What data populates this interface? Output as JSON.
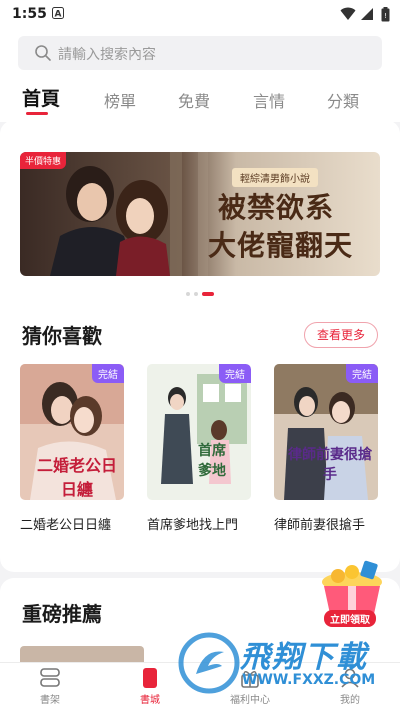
{
  "status_bar": {
    "time": "1:55"
  },
  "search": {
    "placeholder": "請輸入搜索內容"
  },
  "tabs": [
    {
      "label": "首頁",
      "active": true
    },
    {
      "label": "榜單",
      "active": false
    },
    {
      "label": "免費",
      "active": false
    },
    {
      "label": "言情",
      "active": false
    },
    {
      "label": "分類",
      "active": false
    }
  ],
  "banner": {
    "tag": "半價特惠",
    "subtitle": "輕綜清男飾小說",
    "title_line1": "被禁欲系",
    "title_line2": "大佬寵翻天"
  },
  "carousel": {
    "count": 3,
    "active_index": 2
  },
  "guess_section": {
    "title": "猜你喜歡",
    "more_label": "查看更多",
    "books": [
      {
        "title": "二婚老公日日纏",
        "badge": "完結",
        "cover_text": "二婚老公日日纏"
      },
      {
        "title": "首席爹地找上門",
        "badge": "完結",
        "cover_text": "首席爹地"
      },
      {
        "title": "律師前妻很搶手",
        "badge": "完結",
        "cover_text": "律師前妻很搶手"
      }
    ]
  },
  "recommend_section": {
    "title": "重磅推薦"
  },
  "gift": {
    "label": "立即領取"
  },
  "bottom_nav": [
    {
      "label": "書架",
      "icon": "bookshelf-icon",
      "active": false
    },
    {
      "label": "書城",
      "icon": "bookstore-icon",
      "active": true
    },
    {
      "label": "福利中心",
      "icon": "gift-center-icon",
      "active": false
    },
    {
      "label": "我的",
      "icon": "profile-icon",
      "active": false
    }
  ],
  "watermark": {
    "text": "飛翔下載",
    "url": "WWW.FXXZ.COM"
  },
  "colors": {
    "accent": "#e8243a",
    "badge": "#8b5cf6",
    "watermark": "#2f8fd6"
  }
}
